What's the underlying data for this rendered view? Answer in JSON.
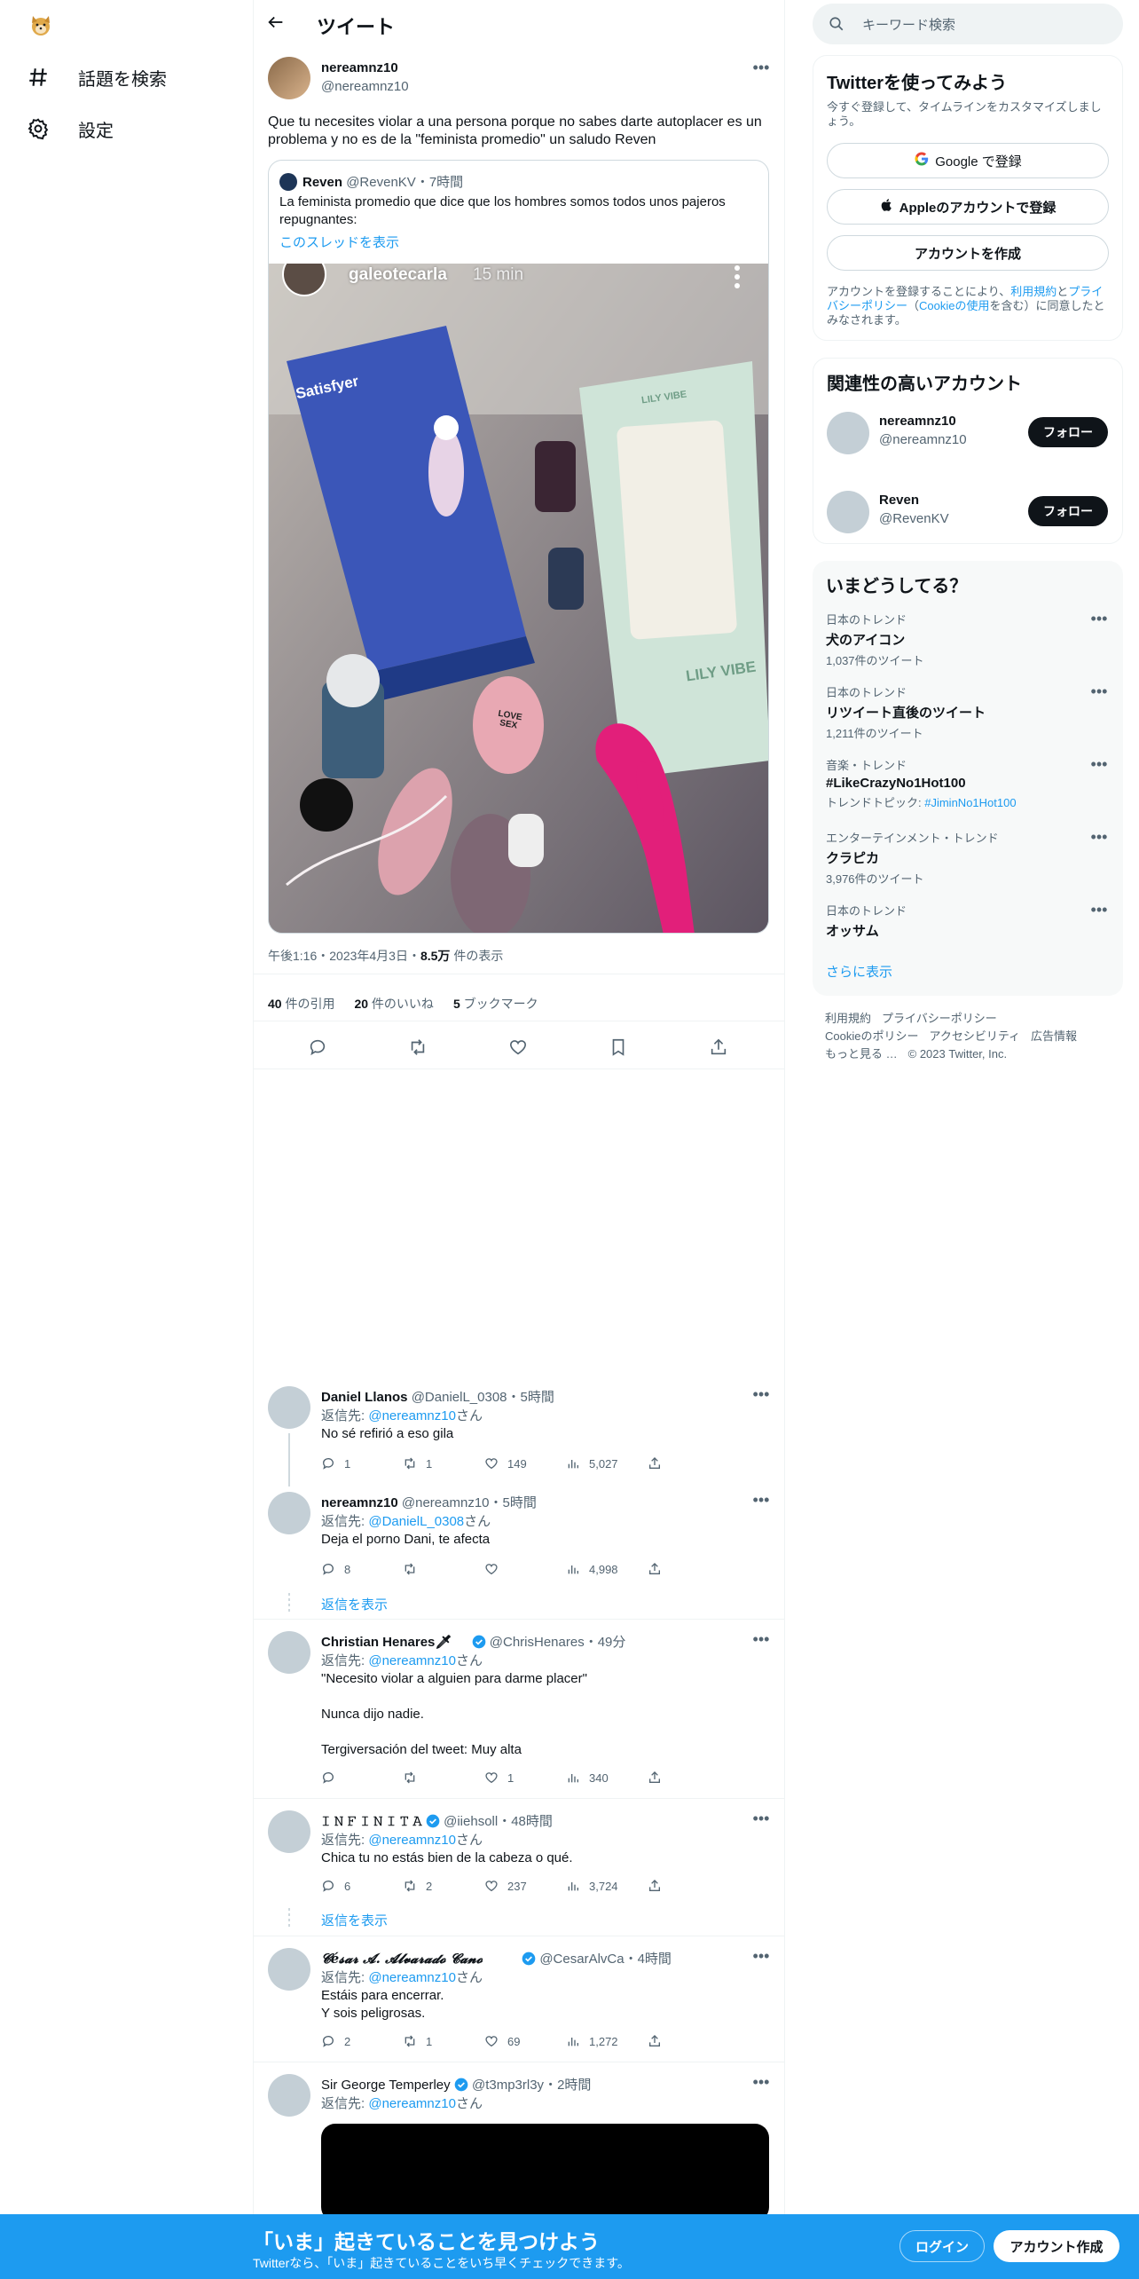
{
  "nav": {
    "explore_label": "話題を検索",
    "settings_label": "設定"
  },
  "header": {
    "title": "ツイート"
  },
  "tweet": {
    "name": "nereamnz10",
    "handle": "@nereamnz10",
    "text": "Que tu necesites violar a una persona porque no sabes darte autoplacer es un problema y no es de la \"feminista promedio\" un saludo Reven",
    "quote": {
      "name": "Reven",
      "handle": "@RevenKV",
      "time": "・7時間",
      "text": "La feminista promedio que dice que los hombres somos todos unos pajeros repugnantes:",
      "show_thread": "このスレッドを表示",
      "media_name": "galeotecarla",
      "media_time": "15 min",
      "media_labels": [
        "Satisfyer",
        "LILY VIBE",
        "LILY VIBE",
        "LOVE SEX"
      ]
    },
    "time": "午後1:16・2023年4月3日・",
    "views_number": "8.5万",
    "views_label": " 件の表示",
    "stats": [
      {
        "num": "40",
        "label": " 件の引用"
      },
      {
        "num": "20",
        "label": " 件のいいね"
      },
      {
        "num": "5",
        "label": " ブックマーク"
      }
    ]
  },
  "replies": [
    {
      "name": "Daniel Llanos",
      "handle": "@DanielL_0308",
      "time": "・5時間",
      "reply_to_prefix": "返信先: ",
      "reply_to": "@nereamnz10",
      "reply_to_suffix": "さん",
      "text": "No sé refirió a eso gila",
      "replies": "1",
      "retweets": "1",
      "likes": "149",
      "views": "5,027"
    },
    {
      "name": "nereamnz10",
      "handle": "@nereamnz10",
      "time": "・5時間",
      "reply_to_prefix": "返信先: ",
      "reply_to": "@DanielL_0308",
      "reply_to_suffix": "さん",
      "text": "Deja el porno Dani, te afecta",
      "replies": "8",
      "retweets": "",
      "likes": "",
      "views": "4,998",
      "show_replies": "返信を表示"
    },
    {
      "name": "Christian Henares🗡",
      "handle": "@ChrisHenares",
      "time": "・49分",
      "reply_to_prefix": "返信先: ",
      "reply_to": "@nereamnz10",
      "reply_to_suffix": "さん",
      "text_lines": [
        "\"Necesito violar a alguien para darme placer\"",
        "Nunca dijo nadie.",
        "Tergiversación del tweet: Muy alta"
      ],
      "replies": "",
      "retweets": "",
      "likes": "1",
      "views": "340"
    },
    {
      "name": "𝙸 𝙽 𝙵 𝙸 𝙽 𝙸 𝚃 𝙰",
      "handle": "@iiehsoll",
      "time": "・48時間",
      "reply_to_prefix": "返信先: ",
      "reply_to": "@nereamnz10",
      "reply_to_suffix": "さん",
      "text": "Chica tu no estás bien de la cabeza o qué.",
      "replies": "6",
      "retweets": "2",
      "likes": "237",
      "views": "3,724",
      "show_replies": "返信を表示"
    },
    {
      "name": "𝓒é𝓼𝓪𝓻 𝓐. 𝓐𝓵𝓿𝓪𝓻𝓪𝓭𝓸 𝓒𝓪𝓷𝓸",
      "handle": "@CesarAlvCa",
      "time": "・4時間",
      "reply_to_prefix": "返信先: ",
      "reply_to": "@nereamnz10",
      "reply_to_suffix": "さん",
      "text_lines": [
        "Estáis para encerrar.",
        "Y sois peligrosas."
      ],
      "replies": "2",
      "retweets": "1",
      "likes": "69",
      "views": "1,272"
    },
    {
      "name": "Sir George Temperley",
      "handle": "@t3mp3rl3y",
      "time": "・2時間",
      "reply_to_prefix": "返信先: ",
      "reply_to": "@nereamnz10",
      "reply_to_suffix": "さん"
    }
  ],
  "right": {
    "search_placeholder": "キーワード検索",
    "signup": {
      "title": "Twitterを使ってみよう",
      "subtitle": "今すぐ登録して、タイムラインをカスタマイズしましょう。",
      "google": "Google で登録",
      "apple": "Appleのアカウントで登録",
      "create": "アカウントを作成",
      "terms_1": "アカウントを登録することにより、",
      "terms_link1": "利用規約",
      "terms_2": "と",
      "terms_link2": "プライバシーポリシー",
      "terms_3": "（",
      "terms_link3": "Cookieの使用",
      "terms_4": "を含む）に同意したとみなされます。"
    },
    "relevant": {
      "title": "関連性の高いアカウント",
      "accounts": [
        {
          "name": "nereamnz10",
          "handle": "@nereamnz10",
          "follow": "フォロー"
        },
        {
          "name": "Reven",
          "handle": "@RevenKV",
          "follow": "フォロー"
        }
      ]
    },
    "trends": {
      "title": "いまどうしてる？",
      "items": [
        {
          "category": "日本のトレンド",
          "name": "犬のアイコン",
          "count": "1,037件のツイート"
        },
        {
          "category": "日本のトレンド",
          "name": "リツイート直後のツイート",
          "count": "1,211件のツイート"
        },
        {
          "category": "音楽・トレンド",
          "name": "#LikeCrazyNo1Hot100",
          "count_prefix": "トレンドトピック: ",
          "count_link": "#JiminNo1Hot100"
        },
        {
          "category": "エンターテインメント・トレンド",
          "name": "クラピカ",
          "count": "3,976件のツイート"
        },
        {
          "category": "日本のトレンド",
          "name": "オッサム",
          "count": ""
        }
      ],
      "show_more": "さらに表示"
    },
    "footer": {
      "line1": [
        "利用規約",
        "プライバシーポリシー"
      ],
      "line2": [
        "Cookieのポリシー",
        "アクセシビリティ",
        "広告情報"
      ],
      "line3": [
        "もっと見る …",
        "© 2023 Twitter, Inc."
      ]
    }
  },
  "bottom_bar": {
    "title": "「いま」起きていることを見つけよう",
    "subtitle": "Twitterなら、「いま」起きていることをいち早くチェックできます。",
    "login": "ログイン",
    "signup": "アカウント作成"
  },
  "colors": {
    "accent": "#1d9bf0",
    "text": "#0f1419",
    "secondary": "#536471"
  }
}
